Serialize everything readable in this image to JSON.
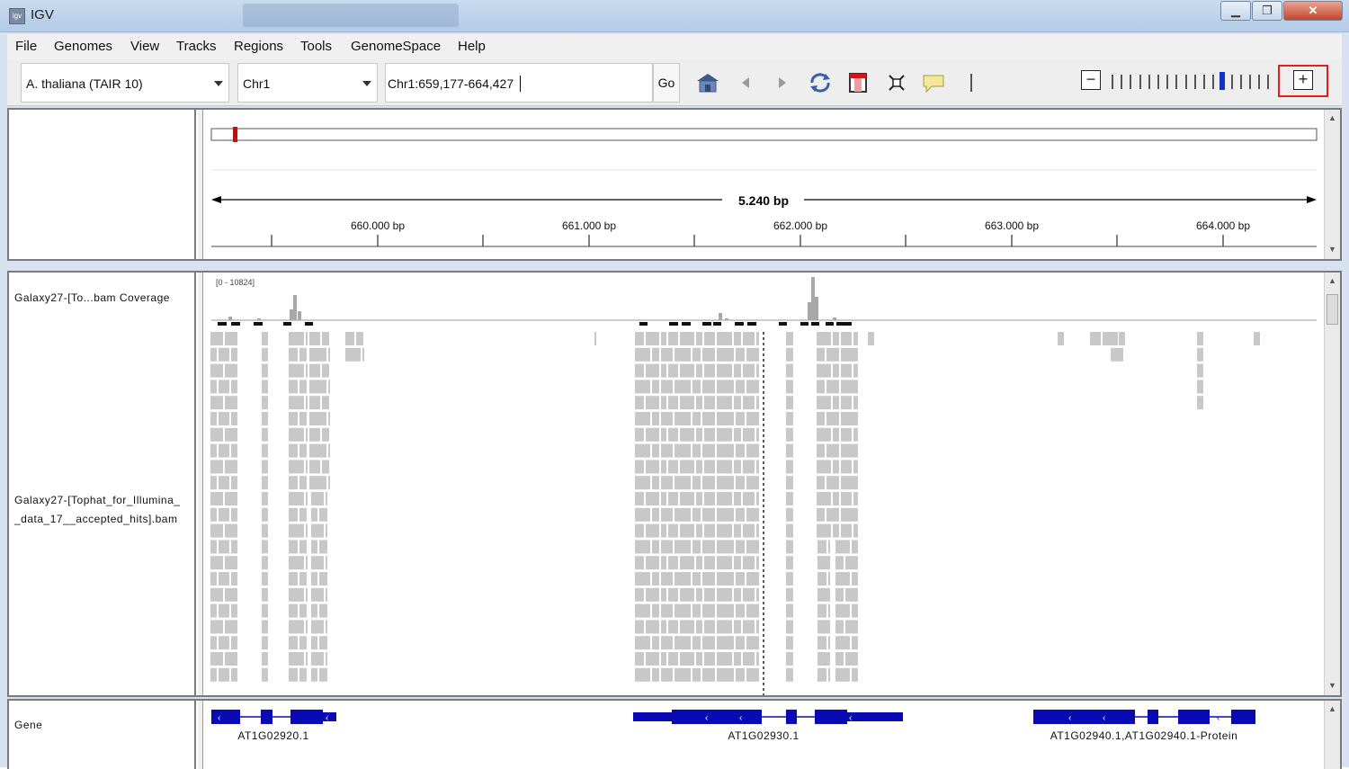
{
  "window": {
    "title": "IGV"
  },
  "menu": [
    "File",
    "Genomes",
    "View",
    "Tracks",
    "Regions",
    "Tools",
    "GenomeSpace",
    "Help"
  ],
  "toolbar": {
    "genome": "A. thaliana (TAIR 10)",
    "chromosome": "Chr1",
    "locus": "Chr1:659,177-664,427",
    "go_label": "Go",
    "zoom_out": "−",
    "zoom_in": "+",
    "zoom_ticks": 18,
    "zoom_level": 12
  },
  "ruler": {
    "span_label": "5.240 bp",
    "ticks": [
      "660.000 bp",
      "661.000 bp",
      "662.000 bp",
      "663.000 bp",
      "664.000 bp"
    ]
  },
  "tracks": {
    "coverage_name": "Galaxy27-[To...bam Coverage",
    "coverage_range": "[0 - 10824]",
    "alignment_name_line1": "Galaxy27-[Tophat_for_Illumina_",
    "alignment_name_line2": "_data_17__accepted_hits].bam",
    "gene_name": "Gene"
  },
  "genes": [
    {
      "label": "AT1G02920.1"
    },
    {
      "label": "AT1G02930.1"
    },
    {
      "label": "AT1G02940.1,AT1G02940.1-Protein"
    }
  ],
  "colors": {
    "gene": "#0a0ab4",
    "read": "#c8c8c8",
    "coverage": "#a8a8a8",
    "ideogram_marker": "#e00000",
    "zoom_highlight": "#e02020"
  }
}
